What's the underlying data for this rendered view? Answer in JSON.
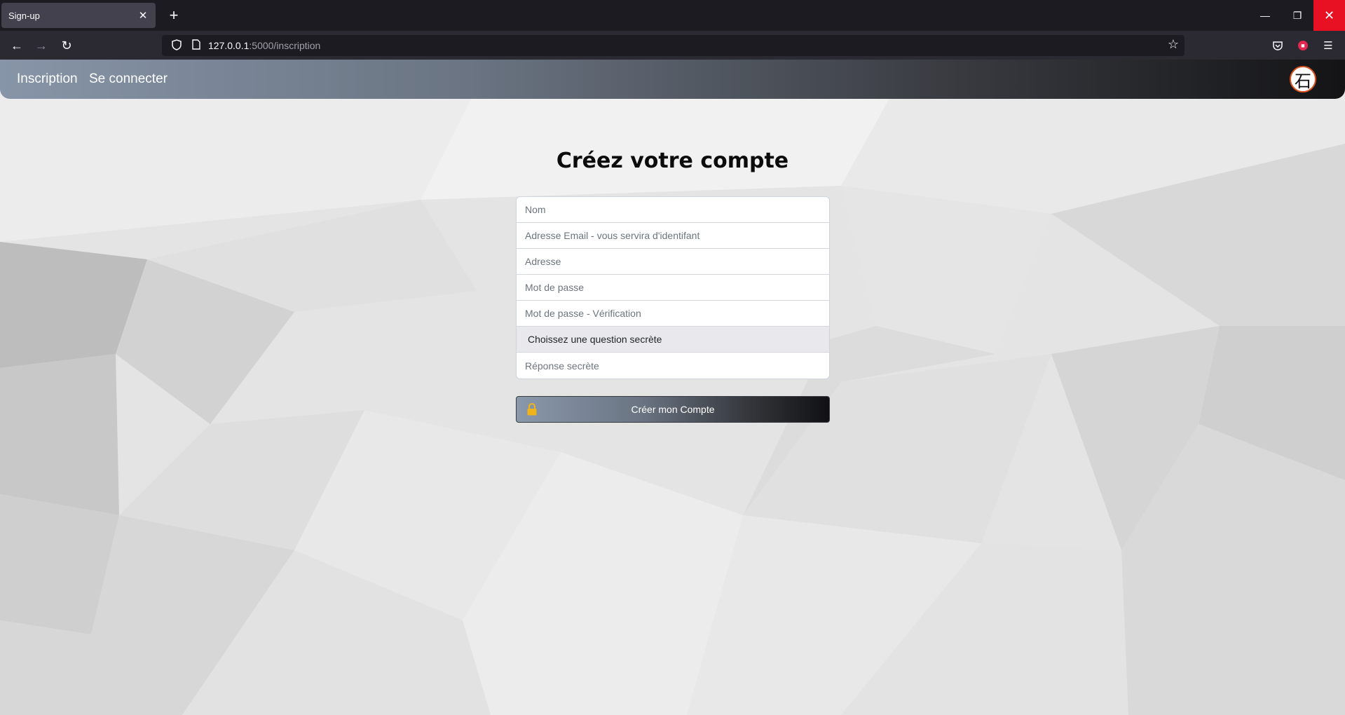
{
  "browser": {
    "tab_title": "Sign-up",
    "tab_close": "✕",
    "new_tab": "+",
    "url_host": "127.0.0.1",
    "url_path": ":5000/inscription",
    "back": "←",
    "forward": "→",
    "reload": "↻",
    "minimize": "—",
    "restore": "❐",
    "close": "✕",
    "icons": [
      "shield-icon",
      "page-icon",
      "star-icon",
      "pocket-icon",
      "extension-icon",
      "menu-icon"
    ]
  },
  "site": {
    "nav": {
      "inscription": "Inscription",
      "login": "Se connecter"
    },
    "logo_char": "石",
    "accent": "#d9531e"
  },
  "form": {
    "title": "Créez votre compte",
    "name_placeholder": "Nom",
    "email_placeholder": "Adresse Email - vous servira d'identifant",
    "address_placeholder": "Adresse",
    "password_placeholder": "Mot de passe",
    "password_verify_placeholder": "Mot de passe - Vérification",
    "secret_question_selected": "Choissez une question secrète",
    "secret_answer_placeholder": "Réponse secrète",
    "submit_label": "Créer mon Compte",
    "lock_color": "#f0b41a"
  }
}
